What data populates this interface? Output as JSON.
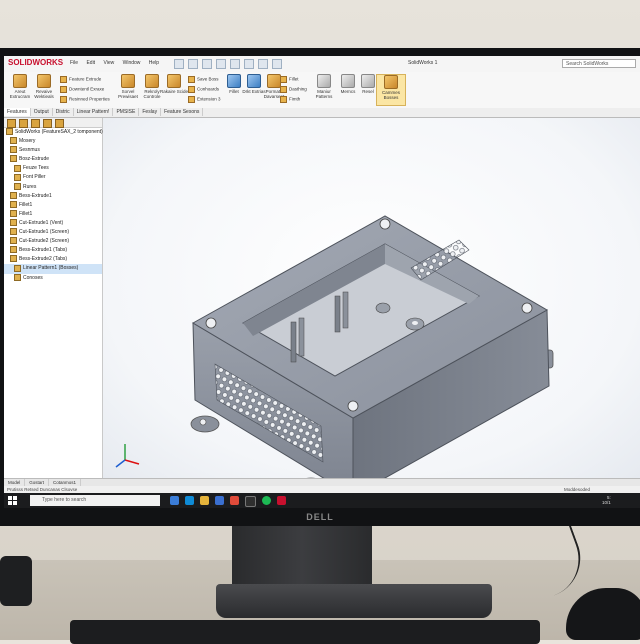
{
  "app": {
    "brand": "SOLIDWORKS",
    "window_title": "SolidWorks 1",
    "menus": [
      "File",
      "Edit",
      "View",
      "Window",
      "Help"
    ],
    "search_placeholder": "Search SolidWorks"
  },
  "ribbon": {
    "buttons": [
      {
        "label": "Areut Extrucram",
        "icon": "extrude-icon"
      },
      {
        "label": "Revaive Wektieals",
        "icon": "revolve-icon"
      },
      {
        "label": "Sorvel Prewisaet",
        "icon": "swept-icon"
      },
      {
        "label": "Rekroly Controle",
        "icon": "loft-icon"
      },
      {
        "label": "Rakaire Scide",
        "icon": "boundary-icon"
      },
      {
        "label": "Fillet",
        "icon": "fillet-icon"
      },
      {
        "label": "Drkt Extrias",
        "icon": "draft-icon"
      },
      {
        "label": "Pormats Davarsent",
        "icon": "pattern-icon"
      },
      {
        "label": "Maniur Patterns",
        "icon": "mirror-icon"
      },
      {
        "label": "Merncs",
        "icon": "reference-icon"
      },
      {
        "label": "Resel",
        "icon": "curves-icon"
      },
      {
        "label": "Cammes Bosses",
        "icon": "instant3d-icon",
        "active": true
      }
    ],
    "small_items": [
      "Feature Extrude",
      "Downtentl Exraxe",
      "Resinned Properties",
      "Save Boss",
      "Conhoards",
      "Extension 3",
      "Fillet",
      "Dasthing",
      "Fimth"
    ]
  },
  "command_tabs": [
    "Features",
    "Output",
    "Distric",
    "Linear Pattern!",
    "PMSISE",
    "Feslay",
    "Feature Sesons"
  ],
  "feature_tree": {
    "root": "SolidWorks (FeatureSAX_2 tomponent)",
    "items": [
      {
        "label": "Mosery",
        "level": 1
      },
      {
        "label": "Sesnmus",
        "level": 1
      },
      {
        "label": "Bosz-Estrude",
        "level": 1
      },
      {
        "label": "Feuze Tees",
        "level": 2
      },
      {
        "label": "Font Piller",
        "level": 2
      },
      {
        "label": "Rures",
        "level": 2
      },
      {
        "label": "Bess-Extrude1",
        "level": 1
      },
      {
        "label": "Fillet1",
        "level": 1
      },
      {
        "label": "Fillet1",
        "level": 1
      },
      {
        "label": "Cut-Extrude1 (Vent)",
        "level": 1
      },
      {
        "label": "Cut-Estrude1 (Screen)",
        "level": 1
      },
      {
        "label": "Cut-Estrude2 (Screen)",
        "level": 1
      },
      {
        "label": "Bess-Extrude1 (Tabs)",
        "level": 1
      },
      {
        "label": "Bess-Extrude2 (Tabs)",
        "level": 1
      },
      {
        "label": "Linear Pattern1 (Bosses)",
        "level": 2
      },
      {
        "label": "Conoses",
        "level": 2
      }
    ]
  },
  "bottom_tabs": [
    "Model",
    "Gostart",
    "Cotanmos1"
  ],
  "status_text": "Prutisss Retsed Duncanas Clsovse",
  "status_right": "Moddesoded",
  "taskbar": {
    "search_placeholder": "Type here to search",
    "clock": "5:",
    "date": "10/1"
  },
  "colors": {
    "model": "#8f96a3",
    "viewport_bg": "#f4f6f9",
    "brand_red": "#c8102e"
  },
  "monitor_brand": "DELL"
}
